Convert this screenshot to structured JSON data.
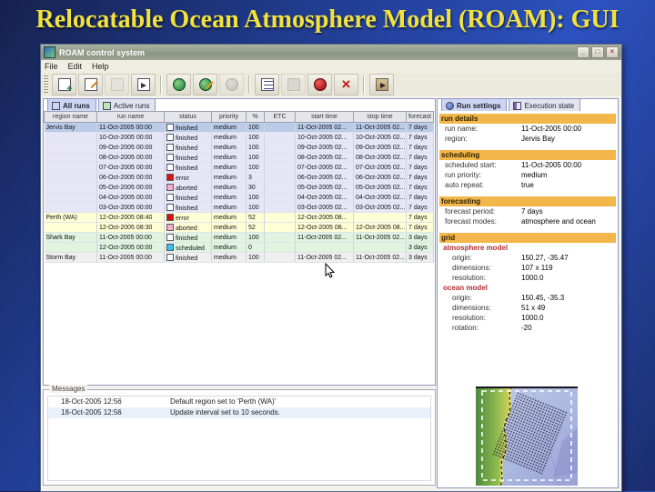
{
  "slide": {
    "title": "Relocatable Ocean Atmosphere Model (ROAM): GUI"
  },
  "window": {
    "title": "ROAM control system",
    "controls": {
      "minimize": "_",
      "maximize": "□",
      "close": "×"
    },
    "menus": [
      {
        "label": "File"
      },
      {
        "label": "Edit"
      },
      {
        "label": "Help"
      }
    ],
    "toolbar": [
      {
        "icon": "new-run-icon",
        "kind": "page-plus",
        "disabled": false,
        "sep_after": false
      },
      {
        "icon": "edit-run-icon",
        "kind": "page-edit",
        "disabled": false,
        "sep_after": false
      },
      {
        "icon": "copy-run-icon",
        "kind": "page-gray",
        "disabled": true,
        "sep_after": false
      },
      {
        "icon": "import-run-icon",
        "kind": "page-import",
        "disabled": false,
        "sep_after": true
      },
      {
        "icon": "new-region-icon",
        "kind": "globe",
        "disabled": false,
        "sep_after": false
      },
      {
        "icon": "edit-region-icon",
        "kind": "globe-edit",
        "disabled": false,
        "sep_after": false
      },
      {
        "icon": "delete-region-icon",
        "kind": "globe-gray",
        "disabled": true,
        "sep_after": true
      },
      {
        "icon": "run-queue-icon",
        "kind": "list",
        "disabled": false,
        "sep_after": false
      },
      {
        "icon": "pause-run-icon",
        "kind": "square-gray",
        "disabled": true,
        "sep_after": false
      },
      {
        "icon": "stop-run-icon",
        "kind": "stop-red",
        "disabled": false,
        "sep_after": false
      },
      {
        "icon": "abort-run-icon",
        "kind": "x-red",
        "disabled": false,
        "sep_after": true
      },
      {
        "icon": "exit-icon",
        "kind": "exit",
        "disabled": false,
        "sep_after": false
      }
    ]
  },
  "left_tabs": [
    {
      "label": "All runs",
      "icon": "table-icon",
      "kind": "table",
      "selected": true
    },
    {
      "label": "Active runs",
      "icon": "active-runs-icon",
      "kind": "active",
      "selected": false
    }
  ],
  "right_tabs": [
    {
      "label": "Run settings",
      "icon": "globe-icon",
      "kind": "globe",
      "selected": true
    },
    {
      "label": "Execution state",
      "icon": "book-icon",
      "kind": "book",
      "selected": false
    }
  ],
  "table": {
    "columns": [
      "region name",
      "run name",
      "status",
      "priority",
      "%",
      "ETC",
      "start time",
      "stop time",
      "forecast"
    ],
    "rows": [
      {
        "region": "Jervis Bay",
        "group": "jervis",
        "selected": true,
        "run": "11-Oct-2005 00:00",
        "status": "finished",
        "priority": "medium",
        "pct": "100",
        "etc": "",
        "start": "11-Oct-2005 02...",
        "stop": "11-Oct-2005 02...",
        "forecast": "7 days"
      },
      {
        "region": "",
        "group": "jervis",
        "selected": false,
        "run": "10-Oct-2005 00:00",
        "status": "finished",
        "priority": "medium",
        "pct": "100",
        "etc": "",
        "start": "10-Oct-2005 02...",
        "stop": "10-Oct-2005 02...",
        "forecast": "7 days"
      },
      {
        "region": "",
        "group": "jervis",
        "selected": false,
        "run": "09-Oct-2005 00:00",
        "status": "finished",
        "priority": "medium",
        "pct": "100",
        "etc": "",
        "start": "09-Oct-2005 02...",
        "stop": "09-Oct-2005 02...",
        "forecast": "7 days"
      },
      {
        "region": "",
        "group": "jervis",
        "selected": false,
        "run": "08-Oct-2005 00:00",
        "status": "finished",
        "priority": "medium",
        "pct": "100",
        "etc": "",
        "start": "08-Oct-2005 02...",
        "stop": "08-Oct-2005 02...",
        "forecast": "7 days"
      },
      {
        "region": "",
        "group": "jervis",
        "selected": false,
        "run": "07-Oct-2005 00:00",
        "status": "finished",
        "priority": "medium",
        "pct": "100",
        "etc": "",
        "start": "07-Oct-2005 02...",
        "stop": "07-Oct-2005 02...",
        "forecast": "7 days"
      },
      {
        "region": "",
        "group": "jervis",
        "selected": false,
        "run": "06-Oct-2005 00:00",
        "status": "error",
        "priority": "medium",
        "pct": "3",
        "etc": "",
        "start": "06-Oct-2005 02...",
        "stop": "06-Oct-2005 02...",
        "forecast": "7 days"
      },
      {
        "region": "",
        "group": "jervis",
        "selected": false,
        "run": "05-Oct-2005 00:00",
        "status": "aborted",
        "priority": "medium",
        "pct": "30",
        "etc": "",
        "start": "05-Oct-2005 02...",
        "stop": "05-Oct-2005 02...",
        "forecast": "7 days"
      },
      {
        "region": "",
        "group": "jervis",
        "selected": false,
        "run": "04-Oct-2005 00:00",
        "status": "finished",
        "priority": "medium",
        "pct": "100",
        "etc": "",
        "start": "04-Oct-2005 02...",
        "stop": "04-Oct-2005 02...",
        "forecast": "7 days"
      },
      {
        "region": "",
        "group": "jervis",
        "selected": false,
        "run": "03-Oct-2005 00:00",
        "status": "finished",
        "priority": "medium",
        "pct": "100",
        "etc": "",
        "start": "03-Oct-2005 02...",
        "stop": "03-Oct-2005 02...",
        "forecast": "7 days"
      },
      {
        "region": "Perth (WA)",
        "group": "perth",
        "selected": false,
        "run": "12-Oct-2005 08:40",
        "status": "error",
        "priority": "medium",
        "pct": "52",
        "etc": "",
        "start": "12-Oct-2005 08...",
        "stop": "",
        "forecast": "7 days"
      },
      {
        "region": "",
        "group": "perth",
        "selected": false,
        "run": "12-Oct-2005 08:30",
        "status": "aborted",
        "priority": "medium",
        "pct": "52",
        "etc": "",
        "start": "12-Oct-2005 08...",
        "stop": "12-Oct-2005 08...",
        "forecast": "7 days"
      },
      {
        "region": "Shark Bay",
        "group": "shark",
        "selected": false,
        "run": "11-Oct-2005 00:00",
        "status": "finished",
        "priority": "medium",
        "pct": "100",
        "etc": "",
        "start": "11-Oct-2005 02...",
        "stop": "11-Oct-2005 02...",
        "forecast": "3 days"
      },
      {
        "region": "",
        "group": "shark",
        "selected": false,
        "run": "12-Oct-2005 00:00",
        "status": "scheduled",
        "priority": "medium",
        "pct": "0",
        "etc": "",
        "start": "",
        "stop": "",
        "forecast": "3 days"
      },
      {
        "region": "Storm Bay",
        "group": "storm",
        "selected": false,
        "run": "11-Oct-2005 00:00",
        "status": "finished",
        "priority": "medium",
        "pct": "100",
        "etc": "",
        "start": "11-Oct-2005 02...",
        "stop": "11-Oct-2005 02...",
        "forecast": "3 days"
      }
    ]
  },
  "details": {
    "sections": [
      {
        "title": "run details",
        "items": [
          {
            "label": "run name:",
            "value": "11-Oct-2005 00:00"
          },
          {
            "label": "region:",
            "value": "Jervis Bay"
          }
        ]
      },
      {
        "title": "scheduling",
        "items": [
          {
            "label": "scheduled start:",
            "value": "11-Oct-2005 00:00"
          },
          {
            "label": "run priority:",
            "value": "medium"
          },
          {
            "label": "auto repeat:",
            "value": "true"
          }
        ]
      },
      {
        "title": "forecasting",
        "items": [
          {
            "label": "forecast period:",
            "value": "7 days"
          },
          {
            "label": "forecast modes:",
            "value": "atmosphere and ocean"
          }
        ]
      },
      {
        "title": "grid",
        "items": [],
        "subsections": [
          {
            "title": "atmosphere model",
            "items": [
              {
                "label": "origin:",
                "value": "150.27, -35.47"
              },
              {
                "label": "dimensions:",
                "value": "107 x 119"
              },
              {
                "label": "resolution:",
                "value": "1000.0"
              }
            ]
          },
          {
            "title": "ocean model",
            "items": [
              {
                "label": "origin:",
                "value": "150.45, -35.3"
              },
              {
                "label": "dimensions:",
                "value": "51 x 49"
              },
              {
                "label": "resolution:",
                "value": "1000.0"
              },
              {
                "label": "rotation:",
                "value": "-20"
              }
            ]
          }
        ]
      }
    ]
  },
  "messages": {
    "title": "Messages",
    "items": [
      {
        "time": "18-Oct-2005 12:56",
        "text": "Default region set to 'Perth (WA)'"
      },
      {
        "time": "18-Oct-2005 12:56",
        "text": "Update interval set to 10 seconds."
      }
    ]
  },
  "colors": {
    "title_text": "#f2e23c",
    "selected_row": "#bccbe9",
    "group_jervis": "#e6e6f7",
    "group_perth": "#ffffd6",
    "group_shark": "#e0f4e0",
    "group_storm": "#efefef",
    "status_finished": "#ffffff",
    "status_error": "#dd1010",
    "status_aborted": "#f8aecb",
    "status_scheduled": "#38c4ee",
    "section_header": "#f2b64a",
    "subsection_text": "#b03030"
  }
}
